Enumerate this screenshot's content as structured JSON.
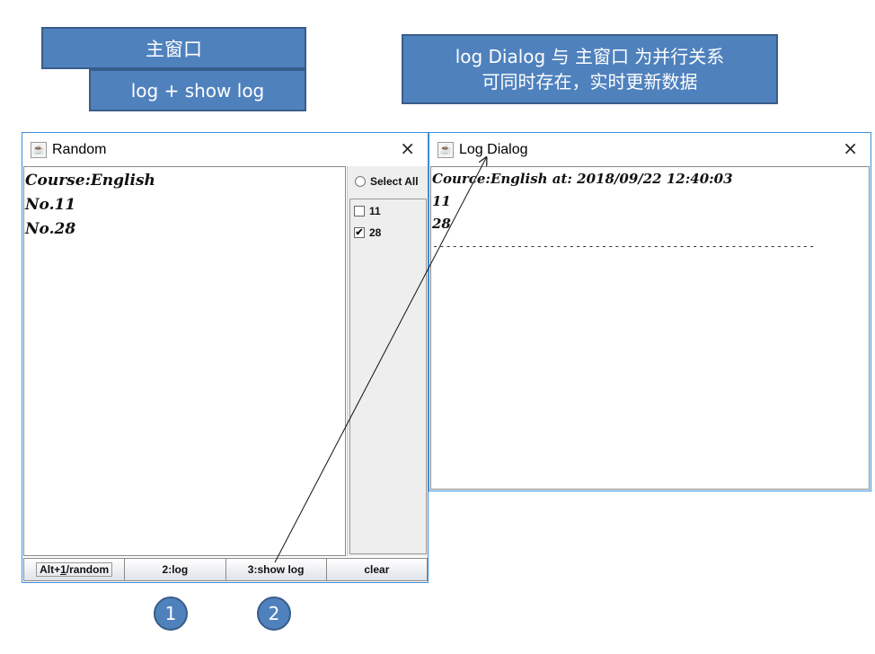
{
  "annotations": {
    "main_window_label": "主窗口",
    "buttons_label": "log + show log",
    "description_line1": "log Dialog 与 主窗口 为并行关系",
    "description_line2": "可同时存在，实时更新数据",
    "circle_1": "1",
    "circle_2": "2"
  },
  "random_window": {
    "title": "Random",
    "close_icon": "×",
    "text_lines": [
      "Course:English",
      "No.11",
      "No.28"
    ],
    "select_all_label": "Select All",
    "checkboxes": [
      {
        "label": "11",
        "checked": false,
        "mark": ""
      },
      {
        "label": "28",
        "checked": true,
        "mark": "✔"
      }
    ],
    "buttons": {
      "random_prefix": "Alt+",
      "random_mnemonic": "1",
      "random_suffix": "/random",
      "log": "2:log",
      "show_log": "3:show log",
      "clear": "clear"
    }
  },
  "log_window": {
    "title": "Log Dialog",
    "close_icon": "×",
    "lines": [
      "Cource:English at: 2018/09/22 12:40:03",
      "11",
      "28"
    ],
    "separator": "-----------------------------------------------------------"
  },
  "colors": {
    "annotation_fill": "#4f81bd",
    "annotation_border": "#385d8a",
    "window_border": "#3c8ed8"
  },
  "icons": {
    "app_icon": "java-cup-icon",
    "close": "close-icon"
  }
}
